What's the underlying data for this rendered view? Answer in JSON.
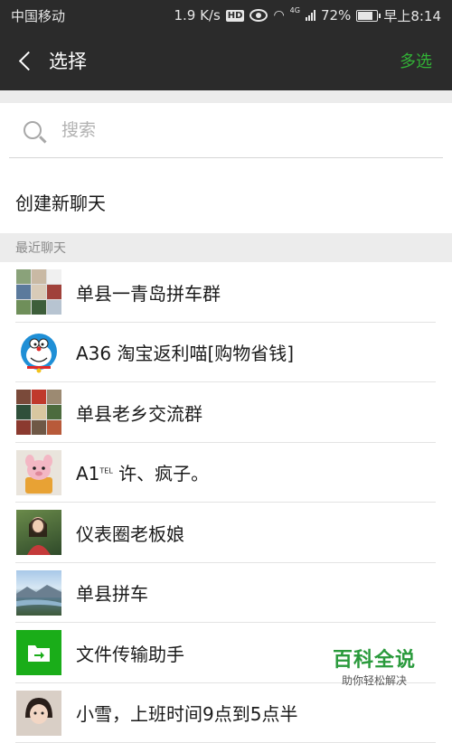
{
  "status_bar": {
    "carrier": "中国移动",
    "speed": "1.9 K/s",
    "hd": "HD",
    "network": "4G",
    "battery": "72%",
    "battery_level": 0.72,
    "time": "早上8:14"
  },
  "header": {
    "title": "选择",
    "multi_select": "多选"
  },
  "search": {
    "placeholder": "搜索"
  },
  "new_chat": "创建新聊天",
  "section_label": "最近聊天",
  "chats": [
    {
      "name": "单县一青岛拼车群",
      "avatar": "group-avatar-icon"
    },
    {
      "name": "A36 淘宝返利喵[购物省钱]",
      "avatar": "doraemon-avatar-icon"
    },
    {
      "name": "单县老乡交流群",
      "avatar": "group-avatar-icon"
    },
    {
      "name": "A1",
      "suffix": "TEL",
      "name_rest": " 许、疯子。",
      "avatar": "toy-avatar-icon"
    },
    {
      "name": "仪表圈老板娘",
      "avatar": "person-avatar-icon"
    },
    {
      "name": "单县拼车",
      "avatar": "landscape-avatar-icon"
    },
    {
      "name": "文件传输助手",
      "avatar": "file-transfer-icon"
    },
    {
      "name": "小雪，上班时间9点到5点半",
      "avatar": "person-avatar-icon"
    }
  ],
  "watermark": {
    "title": "百科全说",
    "subtitle": "助你轻松解决"
  },
  "colors": {
    "dark_bar": "#2b2b2b",
    "accent_green": "#32b136",
    "file_transfer_green": "#1aad19"
  }
}
